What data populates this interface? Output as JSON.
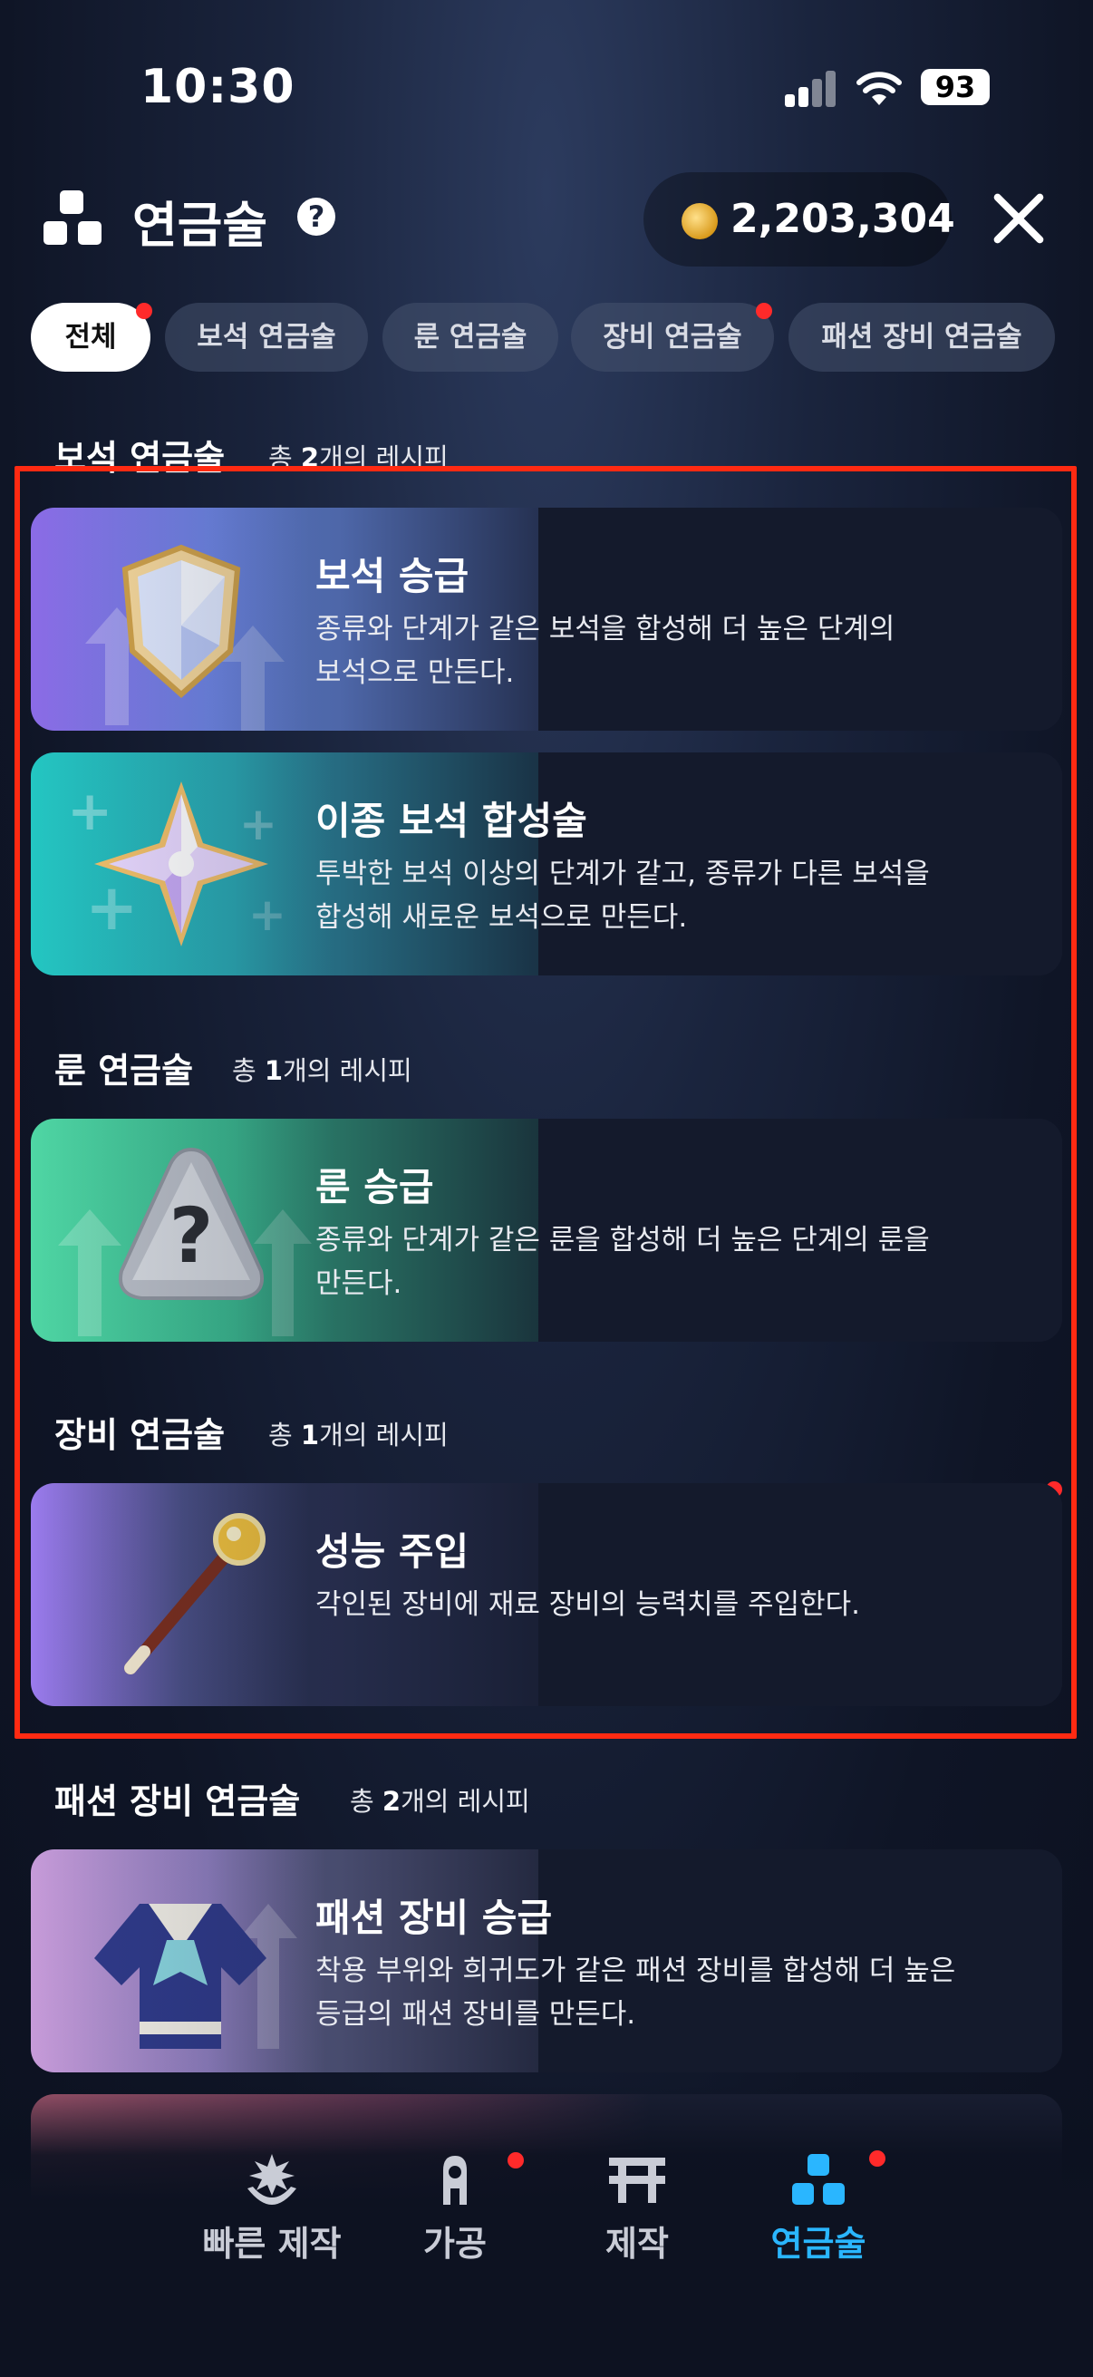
{
  "status_bar": {
    "time": "10:30",
    "battery": "93"
  },
  "header": {
    "title": "연금술",
    "help_icon": "?",
    "currency_value": "2,203,304"
  },
  "tabs": [
    {
      "label": "전체",
      "active": true,
      "has_dot": true
    },
    {
      "label": "보석 연금술",
      "active": false,
      "has_dot": false
    },
    {
      "label": "룬 연금술",
      "active": false,
      "has_dot": false
    },
    {
      "label": "장비 연금술",
      "active": false,
      "has_dot": true
    },
    {
      "label": "패션 장비 연금술",
      "active": false,
      "has_dot": false
    }
  ],
  "sections": [
    {
      "title": "보석 연금술",
      "count_prefix": "총 ",
      "count": "2",
      "count_suffix": "개의 레시피",
      "recipes": [
        {
          "name": "보석 승급",
          "desc_line1": "종류와 단계가 같은 보석을 합성해 더 높은 단계의",
          "desc_line2": "보석으로 만든다.",
          "icon": "gem-shield-icon"
        },
        {
          "name": "이종 보석 합성술",
          "desc_line1": "투박한 보석 이상의 단계가 같고, 종류가 다른 보석을",
          "desc_line2": "합성해 새로운 보석으로 만든다.",
          "icon": "star-gem-icon"
        }
      ]
    },
    {
      "title": "룬 연금술",
      "count_prefix": "총 ",
      "count": "1",
      "count_suffix": "개의 레시피",
      "recipes": [
        {
          "name": "룬 승급",
          "desc_line1": "종류와 단계가 같은 룬을 합성해 더 높은 단계의 룬을",
          "desc_line2": "만든다.",
          "icon": "rune-question-icon"
        }
      ]
    },
    {
      "title": "장비 연금술",
      "count_prefix": "총 ",
      "count": "1",
      "count_suffix": "개의 레시피",
      "recipes": [
        {
          "name": "성능 주입",
          "desc_line1": "각인된 장비에 재료 장비의 능력치를 주입한다.",
          "desc_line2": "",
          "icon": "wand-icon"
        }
      ]
    },
    {
      "title": "패션 장비 연금술",
      "count_prefix": "총 ",
      "count": "2",
      "count_suffix": "개의 레시피",
      "recipes": [
        {
          "name": "패션 장비 승급",
          "desc_line1": "착용 부위와 희귀도가 같은 패션 장비를 합성해 더 높은",
          "desc_line2": "등급의 패션 장비를 만든다.",
          "icon": "outfit-icon"
        }
      ]
    }
  ],
  "bottom_nav": [
    {
      "label": "빠른 제작",
      "icon": "quick-craft-icon",
      "active": false,
      "has_dot": false
    },
    {
      "label": "가공",
      "icon": "processing-icon",
      "active": false,
      "has_dot": true
    },
    {
      "label": "제작",
      "icon": "crafting-icon",
      "active": false,
      "has_dot": false
    },
    {
      "label": "연금술",
      "icon": "alchemy-icon",
      "active": true,
      "has_dot": true
    }
  ],
  "colors": {
    "accent": "#2ab6ff",
    "notification": "#ff2a2a",
    "highlight_box": "#ff2a12"
  }
}
